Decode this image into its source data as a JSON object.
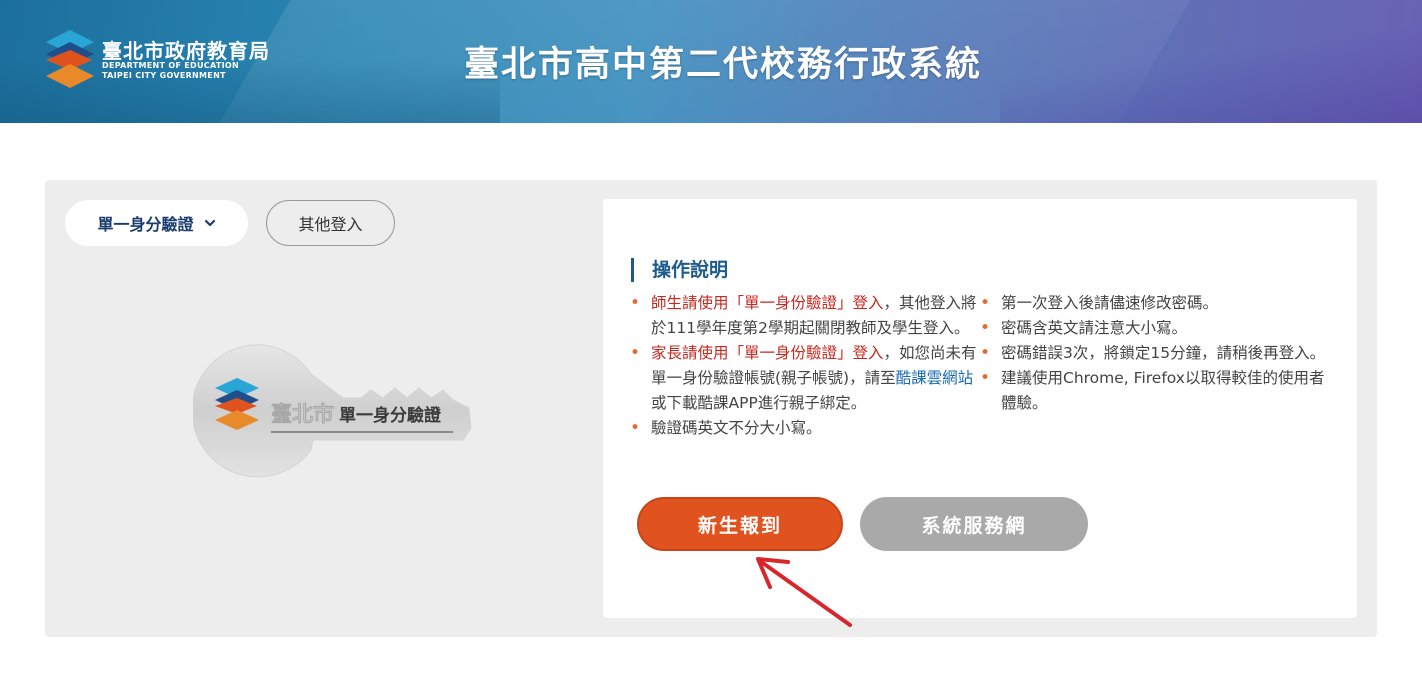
{
  "header": {
    "logo_zh": "臺北市政府教育局",
    "logo_en_line1": "DEPARTMENT OF EDUCATION",
    "logo_en_line2": "TAIPEI CITY GOVERNMENT",
    "site_title": "臺北市高中第二代校務行政系統"
  },
  "tabs": {
    "sso_label": "單一身分驗證",
    "sso_icon": "chevron-down-icon",
    "other_label": "其他登入"
  },
  "key_logo": {
    "city_text": "臺北市",
    "sso_text": "單一身分驗證"
  },
  "instructions": {
    "title": "操作說明",
    "left": [
      {
        "highlight": "師生請使用「單一身份驗證」登入",
        "rest": "，其他登入將於111學年度第2學期起關閉教師及學生登入。"
      },
      {
        "highlight": "家長請使用「單一身份驗證」登入",
        "rest_before_link": "，如您尚未有單一身份驗證帳號(親子帳號)，請至",
        "link": "酷課雲網站",
        "rest_after_link": "或下載酷課APP進行親子綁定。"
      },
      {
        "text": "驗證碼英文不分大小寫。"
      }
    ],
    "right": [
      "第一次登入後請儘速修改密碼。",
      "密碼含英文請注意大小寫。",
      "密碼錯誤3次，將鎖定15分鐘，請稍後再登入。",
      "建議使用Chrome, Firefox以取得較佳的使用者體驗。"
    ]
  },
  "buttons": {
    "new_student": "新生報到",
    "system_service": "系統服務網"
  },
  "colors": {
    "primary_orange": "#e0531f",
    "gray_button": "#a9a9a9",
    "title_blue": "#1c5b8a",
    "highlight_red": "#c8281e",
    "link_blue": "#1a6bb5",
    "annotation_arrow": "#d9262b"
  }
}
